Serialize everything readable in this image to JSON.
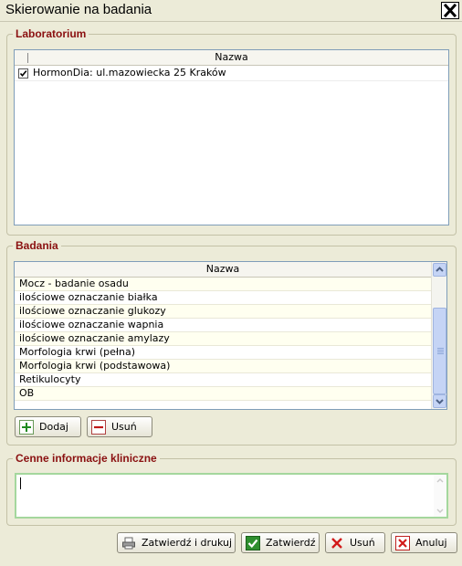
{
  "window": {
    "title": "Skierowanie na badania"
  },
  "laboratory": {
    "legend": "Laboratorium",
    "column_header": "Nazwa",
    "rows": [
      {
        "checked": true,
        "name": "HormonDia: ul.mazowiecka 25 Kraków"
      }
    ]
  },
  "tests": {
    "legend": "Badania",
    "column_header": "Nazwa",
    "rows": [
      "Mocz - badanie osadu",
      "ilościowe oznaczanie białka",
      "ilościowe oznaczanie glukozy",
      "ilościowe oznaczanie wapnia",
      "ilościowe oznaczanie amylazy",
      "Morfologia krwi (pełna)",
      "Morfologia krwi (podstawowa)",
      "Retikulocyty",
      "OB"
    ],
    "add_label": "Dodaj",
    "remove_label": "Usuń"
  },
  "clinical": {
    "legend": "Cenne informacje kliniczne",
    "value": ""
  },
  "footer": {
    "confirm_print_label": "Zatwierdź i drukuj",
    "confirm_label": "Zatwierdź",
    "delete_label": "Usuń",
    "cancel_label": "Anuluj"
  },
  "icons": {
    "close": "close-icon",
    "add": "plus-icon",
    "remove": "minus-icon",
    "print": "printer-icon",
    "confirm": "check-icon",
    "delete": "x-icon",
    "cancel": "cancel-icon"
  },
  "colors": {
    "legend": "#8a1010",
    "background": "#ecebd8",
    "scroll": "#c5d4f5",
    "input_border": "#a4d79d"
  }
}
